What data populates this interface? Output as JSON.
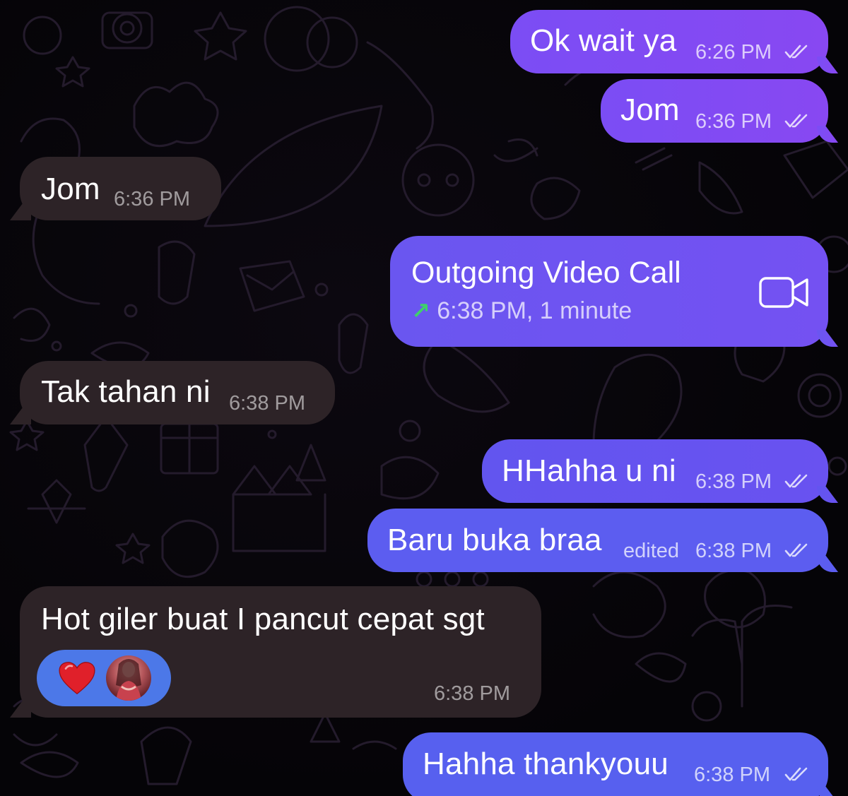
{
  "messages": [
    {
      "id": "m1",
      "direction": "outgoing",
      "text": "Ok wait ya",
      "time": "6:26 PM",
      "read": true
    },
    {
      "id": "m2",
      "direction": "outgoing",
      "text": "Jom",
      "time": "6:36 PM",
      "read": true
    },
    {
      "id": "m3",
      "direction": "incoming",
      "text": "Jom",
      "time": "6:36 PM"
    },
    {
      "id": "m4",
      "direction": "outgoing",
      "type": "call",
      "title": "Outgoing Video Call",
      "details": "6:38 PM, 1 minute",
      "call_icon": "video-camera-icon",
      "arrow_icon": "outgoing-arrow-icon"
    },
    {
      "id": "m5",
      "direction": "incoming",
      "text": "Tak tahan ni",
      "time": "6:38 PM"
    },
    {
      "id": "m6",
      "direction": "outgoing",
      "text": "HHahha u ni",
      "time": "6:38 PM",
      "read": true
    },
    {
      "id": "m7",
      "direction": "outgoing",
      "text": "Baru buka braa",
      "edited_label": "edited",
      "time": "6:38 PM",
      "read": true
    },
    {
      "id": "m8",
      "direction": "incoming",
      "text": "Hot giler buat I pancut cepat sgt",
      "time": "6:38 PM",
      "reaction": {
        "emoji": "heart-icon",
        "by": "avatar"
      }
    },
    {
      "id": "m9",
      "direction": "outgoing",
      "text": "Hahha thankyouu",
      "time": "6:38 PM",
      "read": true
    }
  ],
  "colors": {
    "background": "#050407",
    "outgoing_bubble": "#8848f2",
    "outgoing_bubble_blue": "#5c5df0",
    "incoming_bubble": "#2d2327",
    "reaction_pill": "#4c78e8",
    "call_arrow": "#3fd06b",
    "heart": "#e0202a"
  }
}
